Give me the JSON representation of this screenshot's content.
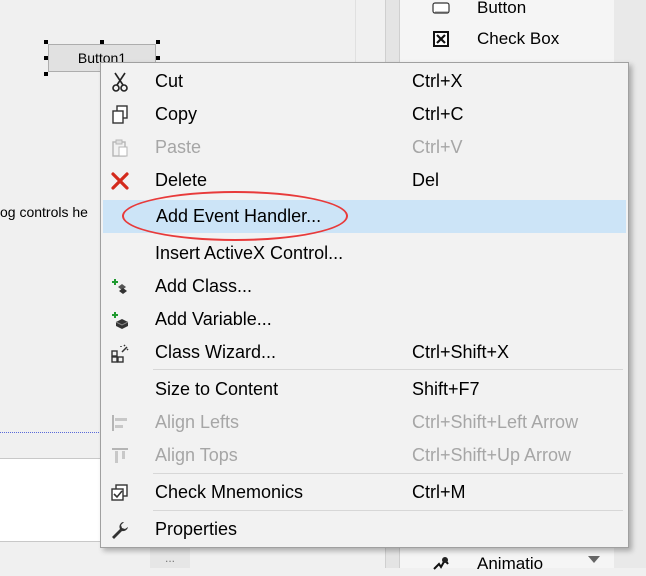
{
  "designer": {
    "button_caption": "Button1",
    "partial_text": "og controls he",
    "scroll_glyph": "..."
  },
  "toolbox": {
    "items": [
      {
        "label": "Button",
        "icon": "button-control-icon"
      },
      {
        "label": "Check Box",
        "icon": "checkbox-control-icon"
      },
      {
        "label": "Animatio",
        "icon": "animation-control-icon"
      }
    ]
  },
  "context_menu": {
    "items": [
      {
        "label": "Cut",
        "shortcut": "Ctrl+X",
        "icon": "scissors-icon",
        "enabled": true
      },
      {
        "label": "Copy",
        "shortcut": "Ctrl+C",
        "icon": "copy-icon",
        "enabled": true
      },
      {
        "label": "Paste",
        "shortcut": "Ctrl+V",
        "icon": "paste-icon",
        "enabled": false
      },
      {
        "label": "Delete",
        "shortcut": "Del",
        "icon": "delete-x-icon",
        "enabled": true
      },
      {
        "label": "Add Event Handler...",
        "shortcut": "",
        "icon": "",
        "enabled": true,
        "highlighted": true
      },
      {
        "label": "Insert ActiveX Control...",
        "shortcut": "",
        "icon": "",
        "enabled": true
      },
      {
        "label": "Add Class...",
        "shortcut": "",
        "icon": "add-class-icon",
        "enabled": true
      },
      {
        "label": "Add Variable...",
        "shortcut": "",
        "icon": "add-variable-icon",
        "enabled": true
      },
      {
        "label": "Class Wizard...",
        "shortcut": "Ctrl+Shift+X",
        "icon": "class-wizard-icon",
        "enabled": true
      },
      {
        "label": "Size to Content",
        "shortcut": "Shift+F7",
        "icon": "",
        "enabled": true
      },
      {
        "label": "Align Lefts",
        "shortcut": "Ctrl+Shift+Left Arrow",
        "icon": "align-lefts-icon",
        "enabled": false
      },
      {
        "label": "Align Tops",
        "shortcut": "Ctrl+Shift+Up Arrow",
        "icon": "align-tops-icon",
        "enabled": false
      },
      {
        "label": "Check Mnemonics",
        "shortcut": "Ctrl+M",
        "icon": "check-mnemonics-icon",
        "enabled": true
      },
      {
        "label": "Properties",
        "shortcut": "",
        "icon": "wrench-icon",
        "enabled": true
      }
    ]
  },
  "colors": {
    "highlight": "#cce4f7",
    "annotation_ring": "#e83a3a",
    "disabled_text": "#a6a6a6"
  }
}
